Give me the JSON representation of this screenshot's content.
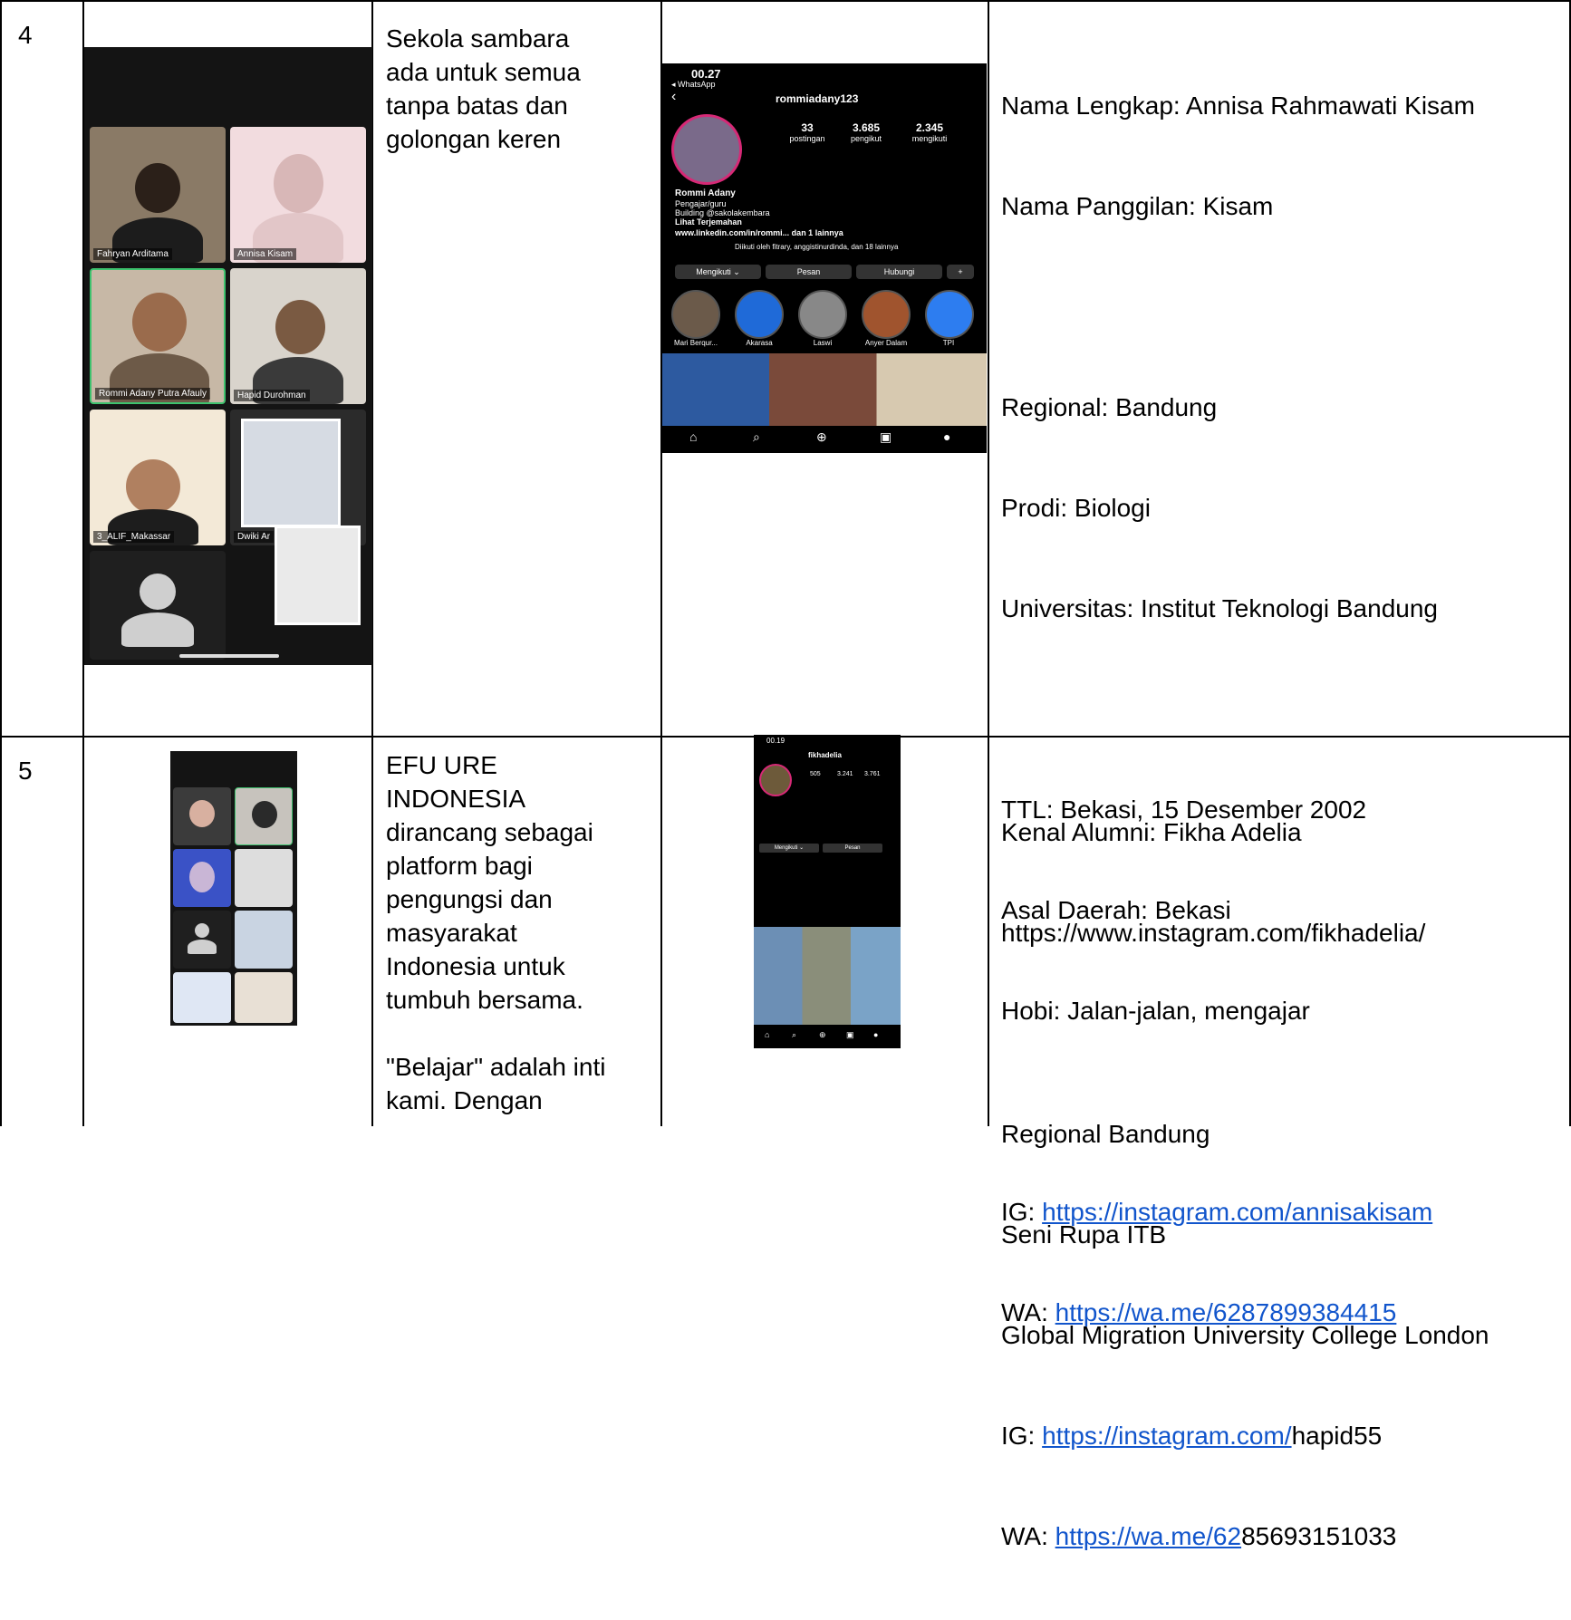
{
  "rows": [
    {
      "number": "4",
      "description": "Sekola sambara\nada untuk semua\ntanpa batas dan\ngolongan keren",
      "meeting_tiles": [
        {
          "name": "Fahryan Arditama"
        },
        {
          "name": "Annisa Kisam"
        },
        {
          "name": "Rommi Adany Putra Afauly"
        },
        {
          "name": "Hapid Durohman"
        },
        {
          "name": "3_ALIF_Makassar"
        },
        {
          "name": "Dwiki Ar"
        }
      ],
      "profile": {
        "time": "00.27",
        "back_app": "◂ WhatsApp",
        "username": "rommiadany123",
        "posts_count": "33",
        "posts_label": "postingan",
        "followers_count": "3.685",
        "followers_label": "pengikut",
        "following_count": "2.345",
        "following_label": "mengikuti",
        "display_name": "Rommi Adany",
        "bio_1": "Pengajar/guru",
        "bio_2": "Building @sakolakembara",
        "bio_3": "Lihat Terjemahan",
        "link": "www.linkedin.com/in/rommi... dan 1 lainnya",
        "followed_by": "Diikuti oleh fitrary, anggistinurdinda, dan 18 lainnya",
        "btn_follow": "Mengikuti ⌄",
        "btn_message": "Pesan",
        "btn_contact": "Hubungi",
        "highlights": [
          "Mari Berqur...",
          "Akarasa",
          "Laswi",
          "Anyer Dalam",
          "TPI"
        ]
      },
      "info_lines": [
        "Nama Lengkap: Annisa Rahmawati Kisam",
        "Nama Panggilan: Kisam",
        "",
        "Regional: Bandung",
        "Prodi: Biologi",
        "Universitas: Institut Teknologi Bandung",
        "",
        "TTL: Bekasi, 15 Desember 2002",
        "Asal Daerah: Bekasi",
        "Hobi: Jalan-jalan, mengajar",
        ""
      ],
      "ig_label": "IG: ",
      "ig_link": "https://instagram.com/annisakisam",
      "wa_label": "WA: ",
      "wa_link": "https://wa.me/6287899384415"
    },
    {
      "number": "5",
      "description": "EFU URE\nINDONESIA\ndirancang sebagai\nplatform bagi\npengungsi dan\nmasyarakat\nIndonesia untuk\ntumbuh bersama.\n\n\"Belajar\" adalah inti\nkami. Dengan",
      "profile": {
        "time": "00.19",
        "username": "fikhadelia",
        "posts_count": "505",
        "followers_count": "3.241",
        "following_count": "3.761",
        "btn_follow": "Mengikuti ⌄",
        "btn_message": "Pesan"
      },
      "info_lines": [
        "Kenal Alumni: Fikha Adelia",
        "https://www.instagram.com/fikhadelia/",
        "",
        "Regional Bandung",
        "Seni Rupa ITB",
        "Global Migration University College London"
      ],
      "ig_label": "IG: ",
      "ig_link": "https://instagram.com/",
      "ig_rest": "hapid55",
      "wa_label": "WA: ",
      "wa_link": "https://wa.me/62",
      "wa_rest": "85693151033"
    }
  ]
}
